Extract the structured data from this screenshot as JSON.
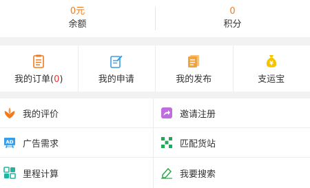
{
  "stats": [
    {
      "value": "0元",
      "label": "余额"
    },
    {
      "value": "0",
      "label": "积分"
    }
  ],
  "quick_actions": [
    {
      "label": "我的订单(",
      "count": "0",
      "suffix": ")",
      "icon": "order-icon",
      "color": "#f27a1b"
    },
    {
      "label": "我的申请",
      "icon": "apply-icon",
      "color": "#3a9ee6"
    },
    {
      "label": "我的发布",
      "icon": "publish-icon",
      "color": "#f2a33a"
    },
    {
      "label": "支运宝",
      "icon": "money-bag-icon",
      "color": "#f5c400"
    }
  ],
  "menu": [
    {
      "label": "我的评价",
      "icon": "review-icon",
      "color": "#f27a1b"
    },
    {
      "label": "邀请注册",
      "icon": "invite-share-icon",
      "color": "#c06ce0"
    },
    {
      "label": "广告需求",
      "icon": "ad-icon",
      "color": "#3a9ee6"
    },
    {
      "label": "匹配货站",
      "icon": "match-station-icon",
      "color": "#21a85a"
    },
    {
      "label": "里程计算",
      "icon": "mileage-calc-icon",
      "color": "#1fb5a0"
    },
    {
      "label": "我要搜索",
      "icon": "search-pen-icon",
      "color": "#2aa84a"
    }
  ]
}
